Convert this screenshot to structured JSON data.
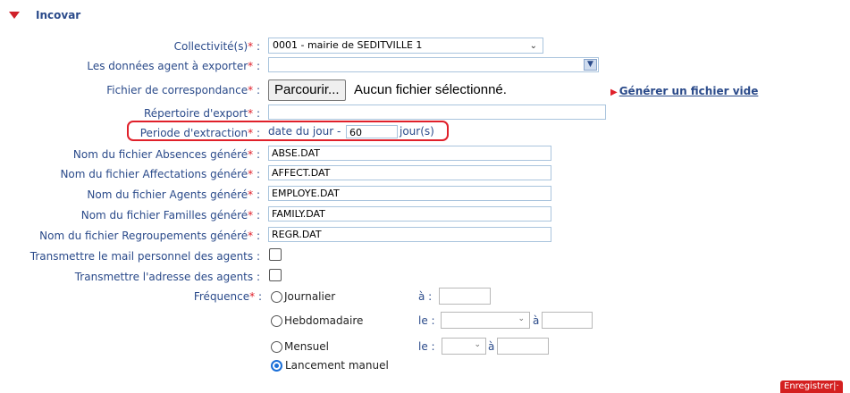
{
  "section": {
    "title": "Incovar"
  },
  "fields": {
    "collectivite": {
      "label": "Collectivité(s)",
      "value": "0001 - mairie de SEDITVILLE 1"
    },
    "donnees": {
      "label": "Les données agent à exporter",
      "value": ""
    },
    "fichier_corresp": {
      "label": "Fichier de correspondance",
      "button": "Parcourir...",
      "status": "Aucun fichier sélectionné."
    },
    "repertoire": {
      "label": "Répertoire d'export",
      "value": ""
    },
    "periode": {
      "label": "Periode d'extraction",
      "prefix": "date du jour -",
      "value": "60",
      "suffix": "jour(s)"
    },
    "absences": {
      "label": "Nom du fichier Absences généré",
      "value": "ABSE.DAT"
    },
    "affectations": {
      "label": "Nom du fichier Affectations généré",
      "value": "AFFECT.DAT"
    },
    "agents": {
      "label": "Nom du fichier Agents généré",
      "value": "EMPLOYE.DAT"
    },
    "familles": {
      "label": "Nom du fichier Familles généré",
      "value": "FAMILY.DAT"
    },
    "regroupements": {
      "label": "Nom du fichier Regroupements généré",
      "value": "REGR.DAT"
    },
    "mail_perso": {
      "label": "Transmettre le mail personnel des agents"
    },
    "adresse": {
      "label": "Transmettre l'adresse des agents"
    },
    "frequence": {
      "label": "Fréquence"
    }
  },
  "frequency": {
    "journalier": {
      "label": "Journalier",
      "at": "à :"
    },
    "hebdomadaire": {
      "label": "Hebdomadaire",
      "le": "le :",
      "at": "à"
    },
    "mensuel": {
      "label": "Mensuel",
      "le": "le :",
      "at": "à"
    },
    "manuel": {
      "label": "Lancement manuel"
    }
  },
  "links": {
    "generate": "Générer un fichier vide"
  },
  "buttons": {
    "save": "Enregistrer|·"
  },
  "colors": {
    "label": "#2a4a8a",
    "required": "#e0202a",
    "highlight": "#e0202a"
  }
}
